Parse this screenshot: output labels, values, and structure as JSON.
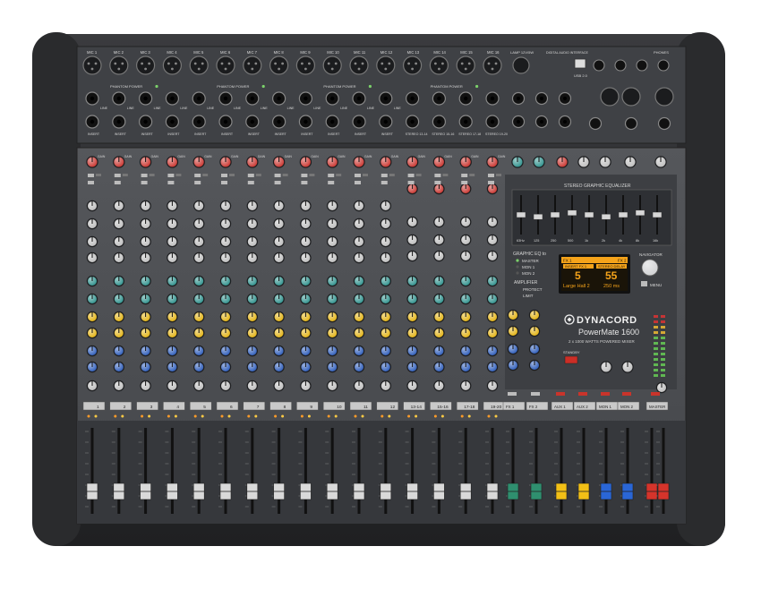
{
  "brand": {
    "name": "DYNACORD",
    "model": "PowerMate 1600",
    "tagline": "2 x 1000 WATTS POWERED MIXER"
  },
  "colors": {
    "chassis": "#2b2c2e",
    "panel": "#4a4c50",
    "panel_dark": "#3a3c40",
    "gain_knob": "#c8302a",
    "eq_knob": "#2a8f8a",
    "aux_knob": "#e2b10e",
    "fx_knob": "#2858b8",
    "pan_knob": "#bdbdbd",
    "display": "#f5a31a",
    "fader_mono": "#d9d9d9",
    "fader_fx": "#2f8f6f",
    "fader_aux": "#f2c016",
    "fader_mon": "#2a66d6",
    "fader_master": "#d5342b"
  },
  "input_section": {
    "mic_labels": [
      "MIC 1",
      "MIC 2",
      "MIC 3",
      "MIC 4",
      "MIC 5",
      "MIC 6",
      "MIC 7",
      "MIC 8",
      "MIC 9",
      "MIC 10",
      "MIC 11",
      "MIC 12",
      "MIC 13",
      "MIC 14",
      "MIC 15",
      "MIC 16"
    ],
    "phantom_labels": [
      "PHANTOM POWER",
      "PHANTOM POWER",
      "PHANTOM POWER",
      "PHANTOM POWER"
    ],
    "line_label": "LINE",
    "insert_label": "INSERT",
    "stereo_labels": [
      "STEREO 13-14",
      "STEREO 15-16",
      "STEREO 17-18",
      "STEREO 19-20"
    ],
    "digital_label": "DIGITAL AUDIO INTERFACE",
    "usb_label": "USB 2.0",
    "lamp_label": "LAMP 12V/5W",
    "phones_label": "PHONES"
  },
  "channel_strip": {
    "gain_label": "GAIN",
    "channel_numbers": [
      "1",
      "2",
      "3",
      "4",
      "5",
      "6",
      "7",
      "8",
      "9",
      "10",
      "11",
      "12",
      "13-14",
      "15-16",
      "17-18",
      "19-20"
    ],
    "return_labels": [
      "FX 1",
      "FX 2",
      "AUX 1",
      "AUX 2",
      "MON 1",
      "MON 2",
      "MASTER"
    ]
  },
  "master_section": {
    "eq_label": "STEREO GRAPHIC EQUALIZER",
    "eq_bands": [
      "63Hz",
      "125",
      "250",
      "500",
      "1k",
      "2k",
      "4k",
      "8k",
      "16k"
    ],
    "eq_levels": [
      0.5,
      0.45,
      0.5,
      0.55,
      0.5,
      0.45,
      0.5,
      0.55,
      0.5
    ],
    "graphic_eq_to": "GRAPHIC EQ to",
    "eq_targets": [
      "MASTER",
      "MON 1",
      "MON 2"
    ],
    "amplifier_label": "AMPLIFIER",
    "amp_modes": [
      "PROTECT",
      "LIMIT"
    ],
    "navigator_label": "NAVIGATOR",
    "menu_label": "MENU",
    "standby_label": "STANDBY"
  },
  "fx_display": {
    "left_title": "INSERT FX 1",
    "right_title": "STEREO DELAY",
    "left_value": "5",
    "right_value": "55",
    "left_sub": "Large Hall 2",
    "right_sub": "250 ms",
    "top_left": "FX 1",
    "top_right": "FX 2"
  }
}
